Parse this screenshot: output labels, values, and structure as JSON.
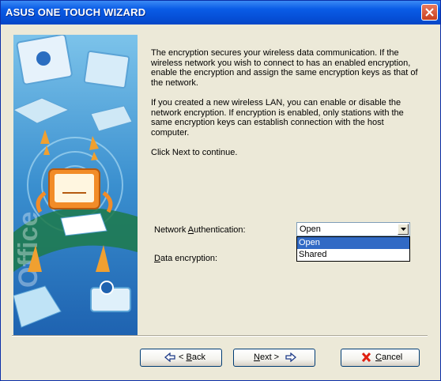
{
  "window": {
    "title": "ASUS ONE TOUCH WIZARD"
  },
  "banner": {
    "word": "Office"
  },
  "description": {
    "paragraphs": [
      "The encryption secures your wireless data communication. If the wireless network you wish to connect to has an enabled encryption, enable the encryption and assign the same encryption keys as that of the network.",
      "If you created a new wireless LAN, you can enable or disable the network encryption. If encryption is enabled, only stations with the same encryption keys can establish connection with the host computer.",
      "Click Next to continue."
    ]
  },
  "form": {
    "auth_label_pre": "Network ",
    "auth_label_key": "A",
    "auth_label_post": "uthentication:",
    "auth_value": "Open",
    "auth_options": [
      "Open",
      "Shared"
    ],
    "auth_selected_index": 0,
    "enc_label_key": "D",
    "enc_label_post": "ata encryption:"
  },
  "buttons": {
    "back": {
      "pre": "< ",
      "key": "B",
      "post": "ack"
    },
    "next": {
      "key": "N",
      "post": "ext >"
    },
    "cancel": {
      "key": "C",
      "post": "ancel"
    }
  },
  "colors": {
    "title_bar": "#0650d8",
    "selection": "#316ac5",
    "cancel_icon": "#e02010",
    "arrow_icon": "#1f3c88"
  }
}
